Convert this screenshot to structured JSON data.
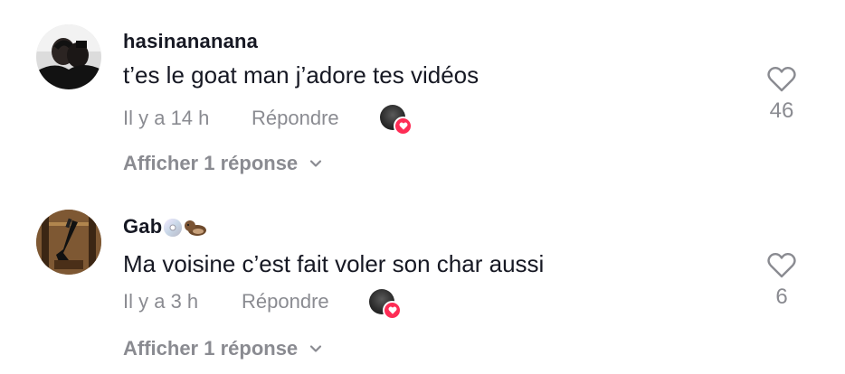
{
  "comments": [
    {
      "username": "hasinananana",
      "text": "t’es le goat man j’adore tes vidéos",
      "time": "Il y a 14 h",
      "reply_label": "Répondre",
      "view_replies": "Afficher 1 réponse",
      "likes": "46",
      "avatar_icon": "person-photo-avatar",
      "creator_liked": true
    },
    {
      "username": "Gab",
      "username_emojis": [
        "cd-disc-emoji",
        "otter-emoji"
      ],
      "text": "Ma voisine c’est fait voler son char aussi",
      "time": "Il y a 3 h",
      "reply_label": "Répondre",
      "view_replies": "Afficher 1 réponse",
      "likes": "6",
      "avatar_icon": "guitar-photo-avatar",
      "creator_liked": true
    }
  ],
  "colors": {
    "text_primary": "#161823",
    "text_secondary": "#8a8b91",
    "creator_heart": "#fe2c55"
  }
}
